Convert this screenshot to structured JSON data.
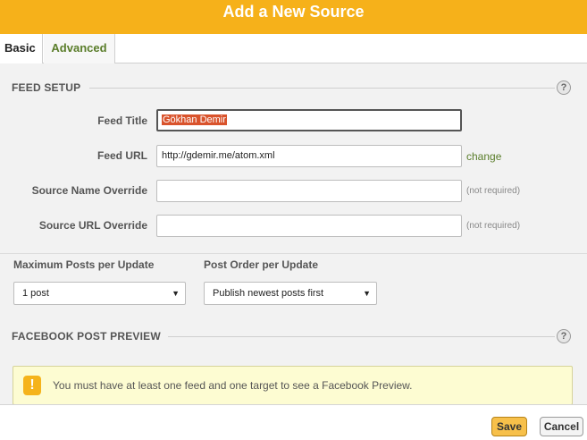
{
  "dialog": {
    "title": "Add a New Source"
  },
  "tabs": [
    {
      "label": "Basic",
      "active": true
    },
    {
      "label": "Advanced",
      "active": false
    }
  ],
  "feed_setup": {
    "title": "FEED SETUP",
    "help": "?",
    "fields": {
      "feed_title": {
        "label": "Feed Title",
        "value": "Gökhan Demir"
      },
      "feed_url": {
        "label": "Feed URL",
        "value": "http://gdemir.me/atom.xml",
        "action": "change"
      },
      "source_name_override": {
        "label": "Source Name Override",
        "value": "",
        "hint": "(not required)"
      },
      "source_url_override": {
        "label": "Source URL Override",
        "value": "",
        "hint": "(not required)"
      }
    }
  },
  "options": {
    "max_posts": {
      "label": "Maximum Posts per Update",
      "selected": "1 post"
    },
    "post_order": {
      "label": "Post Order per Update",
      "selected": "Publish newest posts first"
    }
  },
  "preview": {
    "title": "FACEBOOK POST PREVIEW",
    "help": "?",
    "notice_icon": "!",
    "notice": "You must have at least one feed and one target to see a Facebook Preview."
  },
  "footer": {
    "save_label": "Save",
    "cancel_label": "Cancel"
  },
  "colors": {
    "header": "#f6b11a",
    "accent_green": "#5a7d2a",
    "selection": "#d9532c",
    "notice_bg": "#fdfcd2"
  },
  "icons": {
    "help": "help-icon",
    "warning": "warning-icon",
    "dropdown": "chevron-down-icon"
  }
}
